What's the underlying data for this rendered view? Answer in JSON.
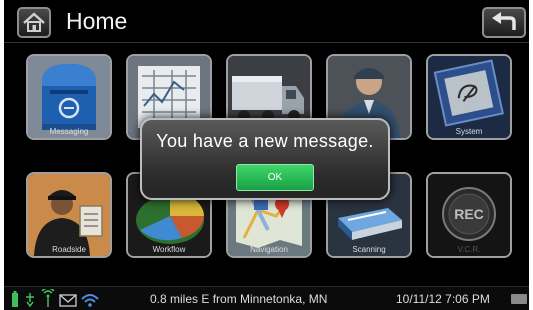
{
  "header": {
    "title": "Home",
    "home_icon": "house-icon",
    "back_icon": "back-arrow-icon"
  },
  "tiles": [
    {
      "id": "messaging",
      "label": "Messaging",
      "icon": "mailbox-icon"
    },
    {
      "id": "forms",
      "label": "",
      "icon": "form-grid-icon"
    },
    {
      "id": "trips",
      "label": "",
      "icon": "truck-icon"
    },
    {
      "id": "driver",
      "label": "",
      "icon": "driver-icon"
    },
    {
      "id": "system",
      "label": "System",
      "icon": "chip-icon"
    },
    {
      "id": "roadside",
      "label": "Roadside",
      "icon": "officer-clipboard-icon"
    },
    {
      "id": "workflow",
      "label": "Workflow",
      "icon": "pie-chart-icon"
    },
    {
      "id": "navigation",
      "label": "Navigation",
      "icon": "map-icon"
    },
    {
      "id": "scanning",
      "label": "Scanning",
      "icon": "scanner-icon"
    },
    {
      "id": "vcr",
      "label": "V.C.R.",
      "icon": "rec-icon"
    }
  ],
  "rec_text": "REC",
  "dialog": {
    "message": "You have a new message.",
    "ok_label": "OK"
  },
  "status_bar": {
    "location": "0.8 miles E from Minnetonka, MN",
    "datetime": "10/11/12 7:06 PM",
    "icons": [
      "battery-icon",
      "gps-icon",
      "signal-icon",
      "envelope-icon",
      "wifi-icon",
      "keyboard-icon"
    ]
  },
  "colors": {
    "background": "#000000",
    "ok_button": "#22b24c",
    "tile_border": "#a0a0a0"
  }
}
